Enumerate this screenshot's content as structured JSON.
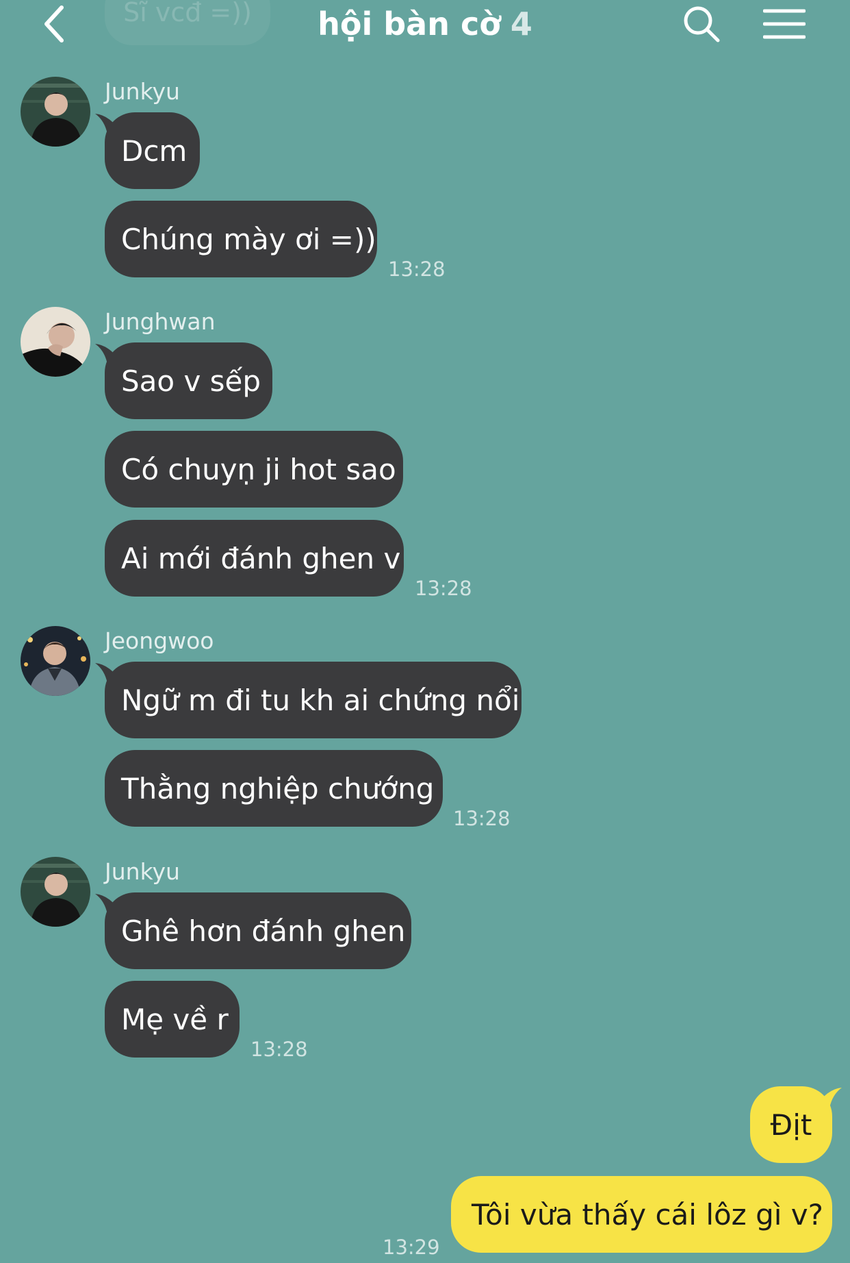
{
  "colors": {
    "background": "#65a49e",
    "incoming_bubble": "#3b3b3d",
    "outgoing_bubble": "#f7e346"
  },
  "header": {
    "title": "hội bàn cờ",
    "member_count": "4",
    "icons": [
      "back-icon",
      "search-icon",
      "menu-icon"
    ],
    "ghost_text": "Sĩ vcđ =))"
  },
  "messages": [
    {
      "sender": "Junkyu",
      "bubbles": [
        "Dcm",
        "Chúng mày ơi =))"
      ],
      "time": "13:28"
    },
    {
      "sender": "Junghwan",
      "bubbles": [
        "Sao v sếp",
        "Có chuyṇ ji hot sao",
        "Ai mới đánh ghen v"
      ],
      "time": "13:28"
    },
    {
      "sender": "Jeongwoo",
      "bubbles": [
        "Ngữ m đi tu kh ai chứng nổi",
        "Thằng nghiệp chướng"
      ],
      "time": "13:28"
    },
    {
      "sender": "Junkyu",
      "bubbles": [
        "Ghê hơn đánh ghen",
        "Mẹ về r"
      ],
      "time": "13:28"
    }
  ],
  "outgoing": {
    "bubbles": [
      "Địt",
      "Tôi vừa thấy cái lôz gì v?"
    ],
    "time": "13:29"
  }
}
